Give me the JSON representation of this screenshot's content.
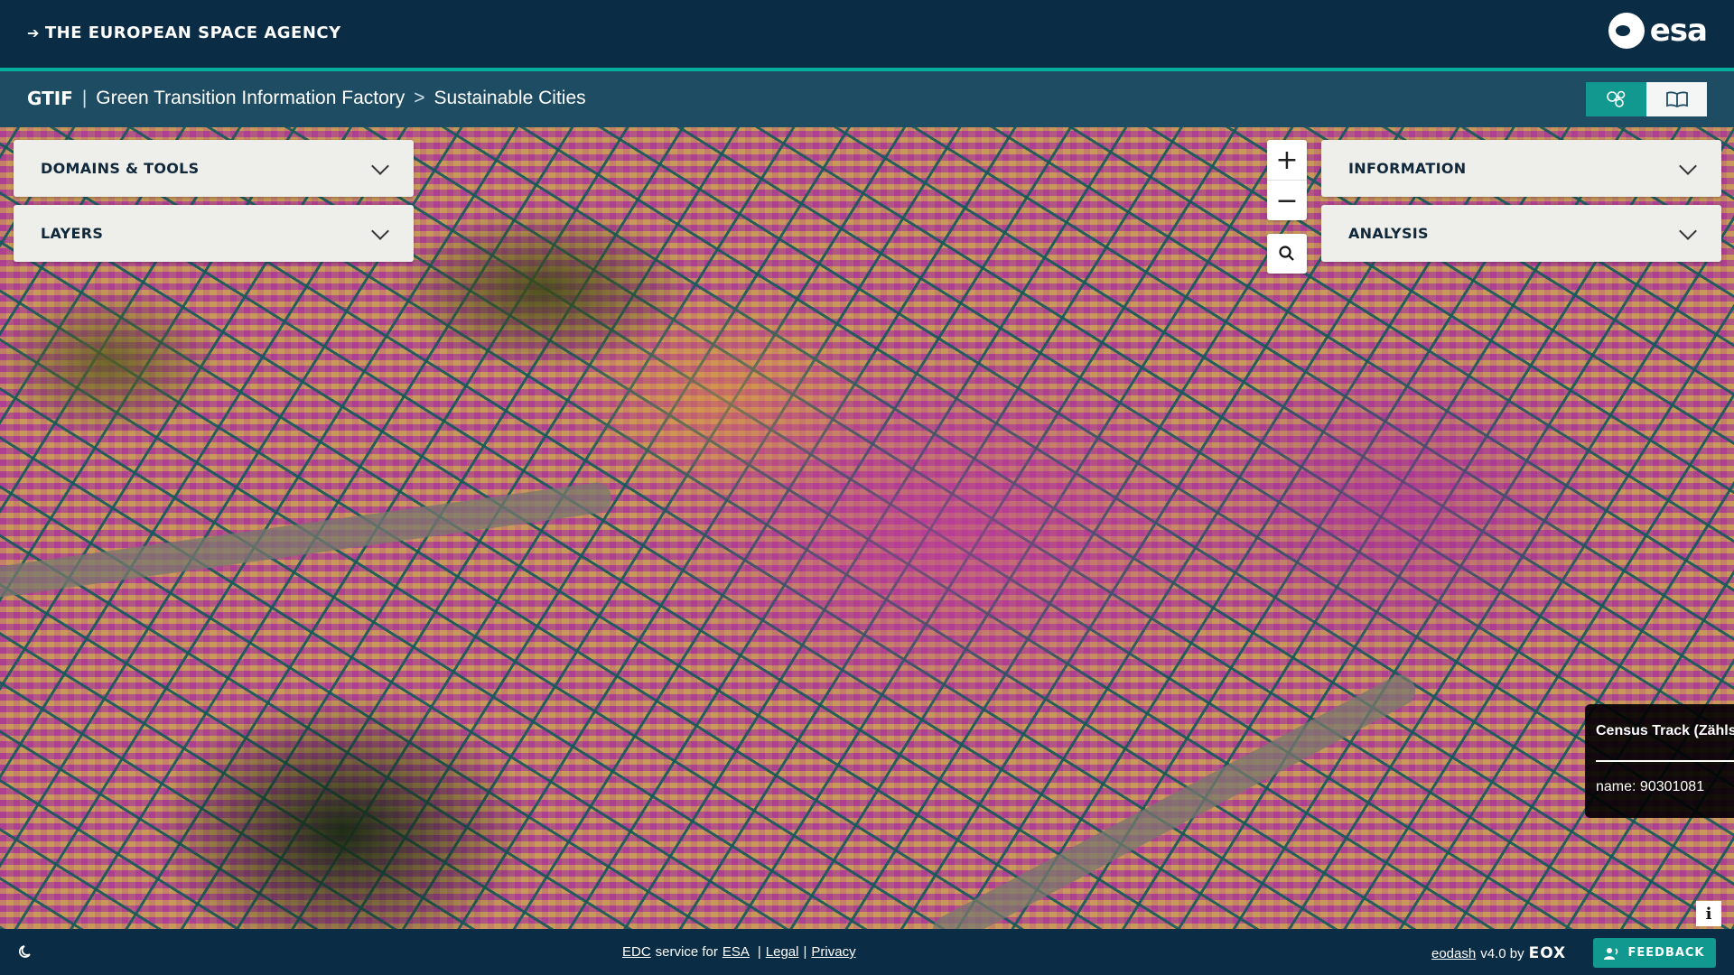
{
  "esa_header": {
    "agency_label": "THE EUROPEAN SPACE AGENCY",
    "logo_text": "esa"
  },
  "app_header": {
    "brand": "GTIF",
    "separator": "|",
    "section": "Green Transition Information Factory",
    "chevron": ">",
    "page": "Sustainable Cities",
    "buttons": [
      {
        "icon": "satellite-domains-icon",
        "active": true
      },
      {
        "icon": "book-stories-icon",
        "active": false
      }
    ]
  },
  "map": {
    "left_panels": [
      {
        "title": "DOMAINS & TOOLS"
      },
      {
        "title": "LAYERS"
      }
    ],
    "right_panels": [
      {
        "title": "INFORMATION"
      },
      {
        "title": "ANALYSIS"
      }
    ],
    "zoom_in": "+",
    "zoom_out": "−",
    "tooltip": {
      "title": "Census Track (Zählsprengel)",
      "row": "name: 90301081"
    },
    "info_button": "i"
  },
  "footer": {
    "edc": "EDC",
    "service_for": "service for",
    "esa": "ESA",
    "pipe1": "|",
    "legal": "Legal",
    "pipe2": "|",
    "privacy": "Privacy",
    "eodash": "eodash",
    "version": "v4.0 by",
    "eox": "EOX",
    "feedback": "FEEDBACK"
  },
  "colors": {
    "esa_navy": "#0b2c45",
    "header_blue": "#1e4d63",
    "accent_teal": "#11998f",
    "panel_bg": "#eeeeea"
  }
}
